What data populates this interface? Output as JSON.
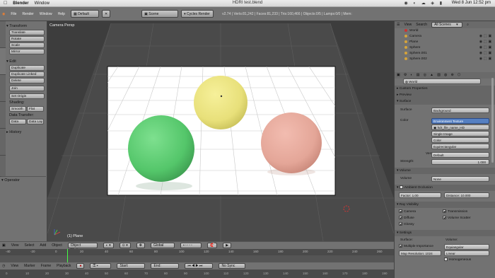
{
  "mac": {
    "app": "Blender",
    "menu": [
      "Window"
    ],
    "title": "HDRI test.blend",
    "clock": "Wed 8 Jun  12:52 pm"
  },
  "info": {
    "menus": [
      "File",
      "Render",
      "Window",
      "Help"
    ],
    "layout": "Default",
    "scene": "Scene",
    "engine": "Cycles Render",
    "stats": "v2.74 | Verts:81,242 | Faces:81,233 | Tris:160,466 | Objects:0/5 | Lamps:0/0 | Mem:"
  },
  "shelf": {
    "transform_header": "Transform",
    "transform_buttons": [
      "Translate",
      "Rotate",
      "Scale",
      "Mirror"
    ],
    "edit_header": "Edit",
    "edit_buttons": [
      "Duplicate",
      "Duplicate Linked",
      "Delete",
      "Join"
    ],
    "set_origin": "Set Origin",
    "shading_label": "Shading:",
    "shading_buttons": [
      "Smooth",
      "Flat"
    ],
    "data_transfer_label": "Data Transfer:",
    "data_transfer_buttons": [
      "Data",
      "Data Lay"
    ],
    "history_header": "History",
    "operator_header": "Operator"
  },
  "viewport": {
    "label": "Camera Persp",
    "object_label": "(1) Plane",
    "spheres": [
      {
        "name": "green-sphere",
        "color": "#54c66a"
      },
      {
        "name": "yellow-sphere",
        "color": "#e8e07a"
      },
      {
        "name": "pink-sphere",
        "color": "#e4a698"
      }
    ]
  },
  "view_header": {
    "items": [
      "View",
      "Select",
      "Add",
      "Object"
    ],
    "mode": "Object Mode",
    "orientation": "Global"
  },
  "timeline": {
    "ruler": [
      "-40",
      "-20",
      "0",
      "20",
      "40",
      "60",
      "80",
      "100",
      "120",
      "140",
      "160",
      "180",
      "200",
      "220",
      "240",
      "260"
    ],
    "items": [
      "View",
      "Marker",
      "Frame",
      "Playback"
    ],
    "start": "Start:",
    "end": "End:",
    "sync": "No Sync",
    "ruler2": [
      "0",
      "10",
      "20",
      "30",
      "40",
      "50",
      "60",
      "70",
      "80",
      "90",
      "100",
      "110",
      "120",
      "130",
      "140",
      "150",
      "160",
      "170",
      "180",
      "190"
    ]
  },
  "outliner": {
    "view": "View",
    "search": "Search",
    "scenes": "All Scenes",
    "rows": [
      "World",
      "Camera",
      "Plane",
      "Sphere",
      "Sphere.001",
      "Sphere.002"
    ]
  },
  "properties": {
    "world_name": "World",
    "custom_properties": "Custom Properties",
    "preview": "Preview",
    "surface_header": "Surface",
    "surface_label": "Surface",
    "surface_value": "Background",
    "color_label": "Color",
    "color_value": "Environment Texture",
    "image_name": "hdr_file_name_HD",
    "image_value": "Single Image",
    "color_space": "Color",
    "projection": "Equirectangular",
    "vector_label": "Vector",
    "vector_value": "Default",
    "strength_label": "Strength:",
    "strength_value": "1.000",
    "volume_header": "Volume",
    "volume_label": "Volume",
    "volume_value": "None",
    "ao_header": "Ambient Occlusion",
    "factor_label": "Factor:",
    "factor_value": "1.00",
    "distance_label": "Distance:",
    "distance_value": "10.000",
    "ray_header": "Ray Visibility",
    "ray_items": [
      "Camera",
      "Transmission",
      "Diffuse",
      "Volume Scatter",
      "Glossy"
    ],
    "settings_header": "Settings",
    "surface_sub": "Surface:",
    "volume_sub": "Volume:",
    "mis_label": "Multiple Importance",
    "map_res_label": "Map Resolution:",
    "map_res_value": "1024",
    "volume_sampling": "Equiangular",
    "volume_interp": "Linear",
    "homogeneous": "Homogeneous"
  }
}
